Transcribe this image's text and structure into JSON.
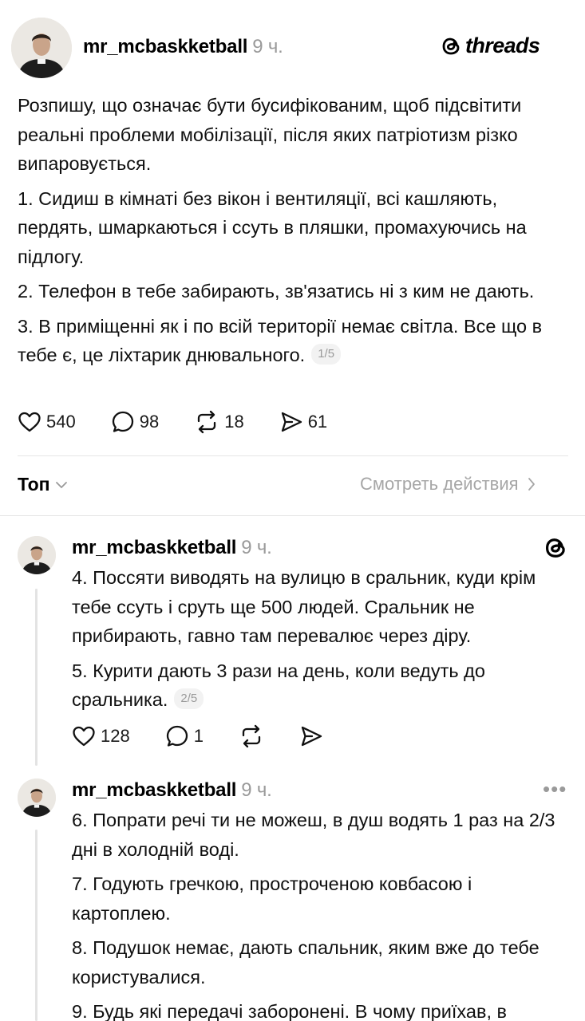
{
  "app": {
    "logo_text": "threads"
  },
  "main_post": {
    "username": "mr_mcbaskketball",
    "time": "9 ч.",
    "paragraphs": [
      "Розпишу, що означає бути бусифікованим, щоб підсвітити реальні проблеми мобілізації, після яких патріотизм різко випаровується.",
      "1. Сидиш в кімнаті без вікон і вентиляції, всі кашляють, пердять, шмаркаються і ссуть в пляшки, промахуючись на підлогу.",
      "2. Телефон в тебе забирають, зв'язатись ні з ким не дають.",
      "3. В приміщенні як і по всій території немає світла. Все що в тебе є, це ліхтарик днювального."
    ],
    "pager": "1/5",
    "likes": "540",
    "comments": "98",
    "reposts": "18",
    "shares": "61"
  },
  "sort_bar": {
    "top_label": "Топ",
    "view_activity": "Смотреть действия"
  },
  "reply_1": {
    "username": "mr_mcbaskketball",
    "time": "9 ч.",
    "paragraphs": [
      "4. Поссяти виводять на вулицю в сральник, куди крім тебе ссуть і сруть ще 500 людей. Сральник не прибирають, гавно там перевалює через діру.",
      "5. Курити дають 3 рази на день, коли ведуть до сральника."
    ],
    "pager": "2/5",
    "likes": "128",
    "comments": "1"
  },
  "reply_2": {
    "username": "mr_mcbaskketball",
    "time": "9 ч.",
    "more": "•••",
    "paragraphs": [
      "6. Попрати речі ти не можеш, в душ водять 1 раз на 2/3 дні в холодній воді.",
      "7. Годують гречкою, простроченою ковбасою і картоплею.",
      "8. Подушок немає, дають спальник, яким вже до тебе користувалися.",
      "9. Будь які передачі заборонені. В чому приїхав, в"
    ]
  }
}
